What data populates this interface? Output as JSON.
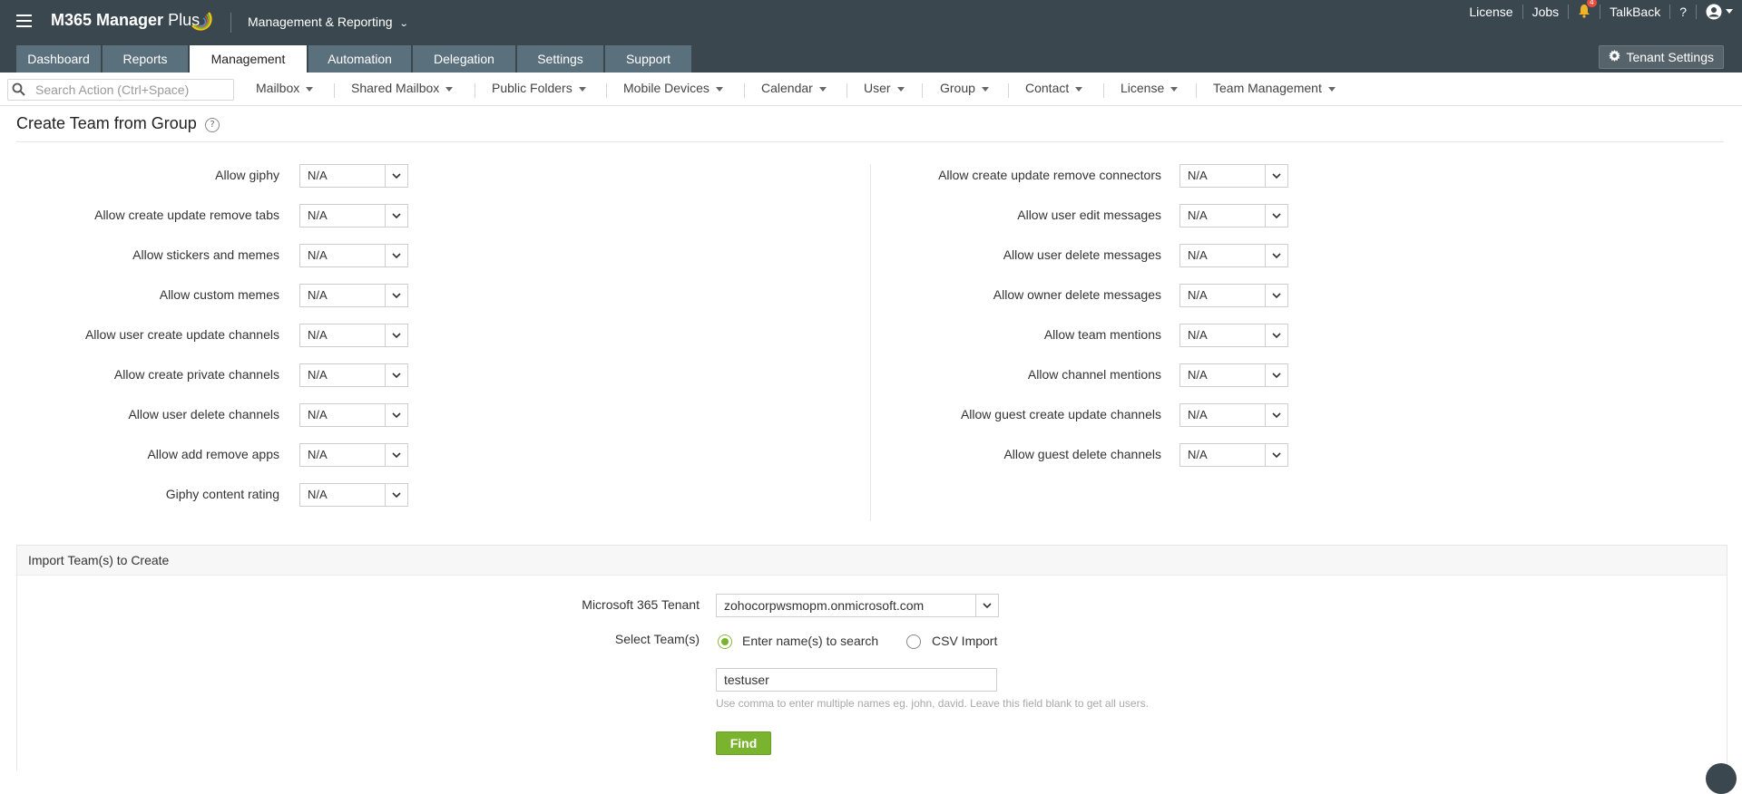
{
  "app": {
    "brand_bold": "M365 Manager",
    "brand_thin": "Plus",
    "module_switch": "Management & Reporting",
    "accent_color": "#7ab32e",
    "header_color": "#3a474f",
    "tab_color": "#5b707d"
  },
  "toplinks": {
    "license": "License",
    "jobs": "Jobs",
    "notification_count": "4",
    "talkback": "TalkBack",
    "help": "?"
  },
  "tabs": [
    {
      "label": "Dashboard",
      "active": false
    },
    {
      "label": "Reports",
      "active": false
    },
    {
      "label": "Management",
      "active": true
    },
    {
      "label": "Automation",
      "active": false
    },
    {
      "label": "Delegation",
      "active": false
    },
    {
      "label": "Settings",
      "active": false
    },
    {
      "label": "Support",
      "active": false
    }
  ],
  "tenant_settings_label": "Tenant Settings",
  "search": {
    "placeholder": "Search Action (Ctrl+Space)"
  },
  "subnav": [
    "Mailbox",
    "Shared Mailbox",
    "Public Folders",
    "Mobile Devices",
    "Calendar",
    "User",
    "Group",
    "Contact",
    "License",
    "Team Management"
  ],
  "page_title": "Create Team from Group",
  "left_fields": [
    {
      "label": "Allow giphy",
      "value": "N/A"
    },
    {
      "label": "Allow create update remove tabs",
      "value": "N/A"
    },
    {
      "label": "Allow stickers and memes",
      "value": "N/A"
    },
    {
      "label": "Allow custom memes",
      "value": "N/A"
    },
    {
      "label": "Allow user create update channels",
      "value": "N/A"
    },
    {
      "label": "Allow create private channels",
      "value": "N/A"
    },
    {
      "label": "Allow user delete channels",
      "value": "N/A"
    },
    {
      "label": "Allow add remove apps",
      "value": "N/A"
    },
    {
      "label": "Giphy content rating",
      "value": "N/A"
    }
  ],
  "right_fields": [
    {
      "label": "Allow create update remove connectors",
      "value": "N/A"
    },
    {
      "label": "Allow user edit messages",
      "value": "N/A"
    },
    {
      "label": "Allow user delete messages",
      "value": "N/A"
    },
    {
      "label": "Allow owner delete messages",
      "value": "N/A"
    },
    {
      "label": "Allow team mentions",
      "value": "N/A"
    },
    {
      "label": "Allow channel mentions",
      "value": "N/A"
    },
    {
      "label": "Allow guest create update channels",
      "value": "N/A"
    },
    {
      "label": "Allow guest delete channels",
      "value": "N/A"
    }
  ],
  "import": {
    "title": "Import Team(s) to Create",
    "tenant_label": "Microsoft 365 Tenant",
    "tenant_value": "zohocorpwsmopm.onmicrosoft.com",
    "select_label": "Select Team(s)",
    "option_search": "Enter name(s) to search",
    "option_csv": "CSV Import",
    "selected_option": "search",
    "names_value": "testuser",
    "hint": "Use comma to enter multiple names eg. john, david. Leave this field blank to get all users.",
    "find_label": "Find"
  }
}
